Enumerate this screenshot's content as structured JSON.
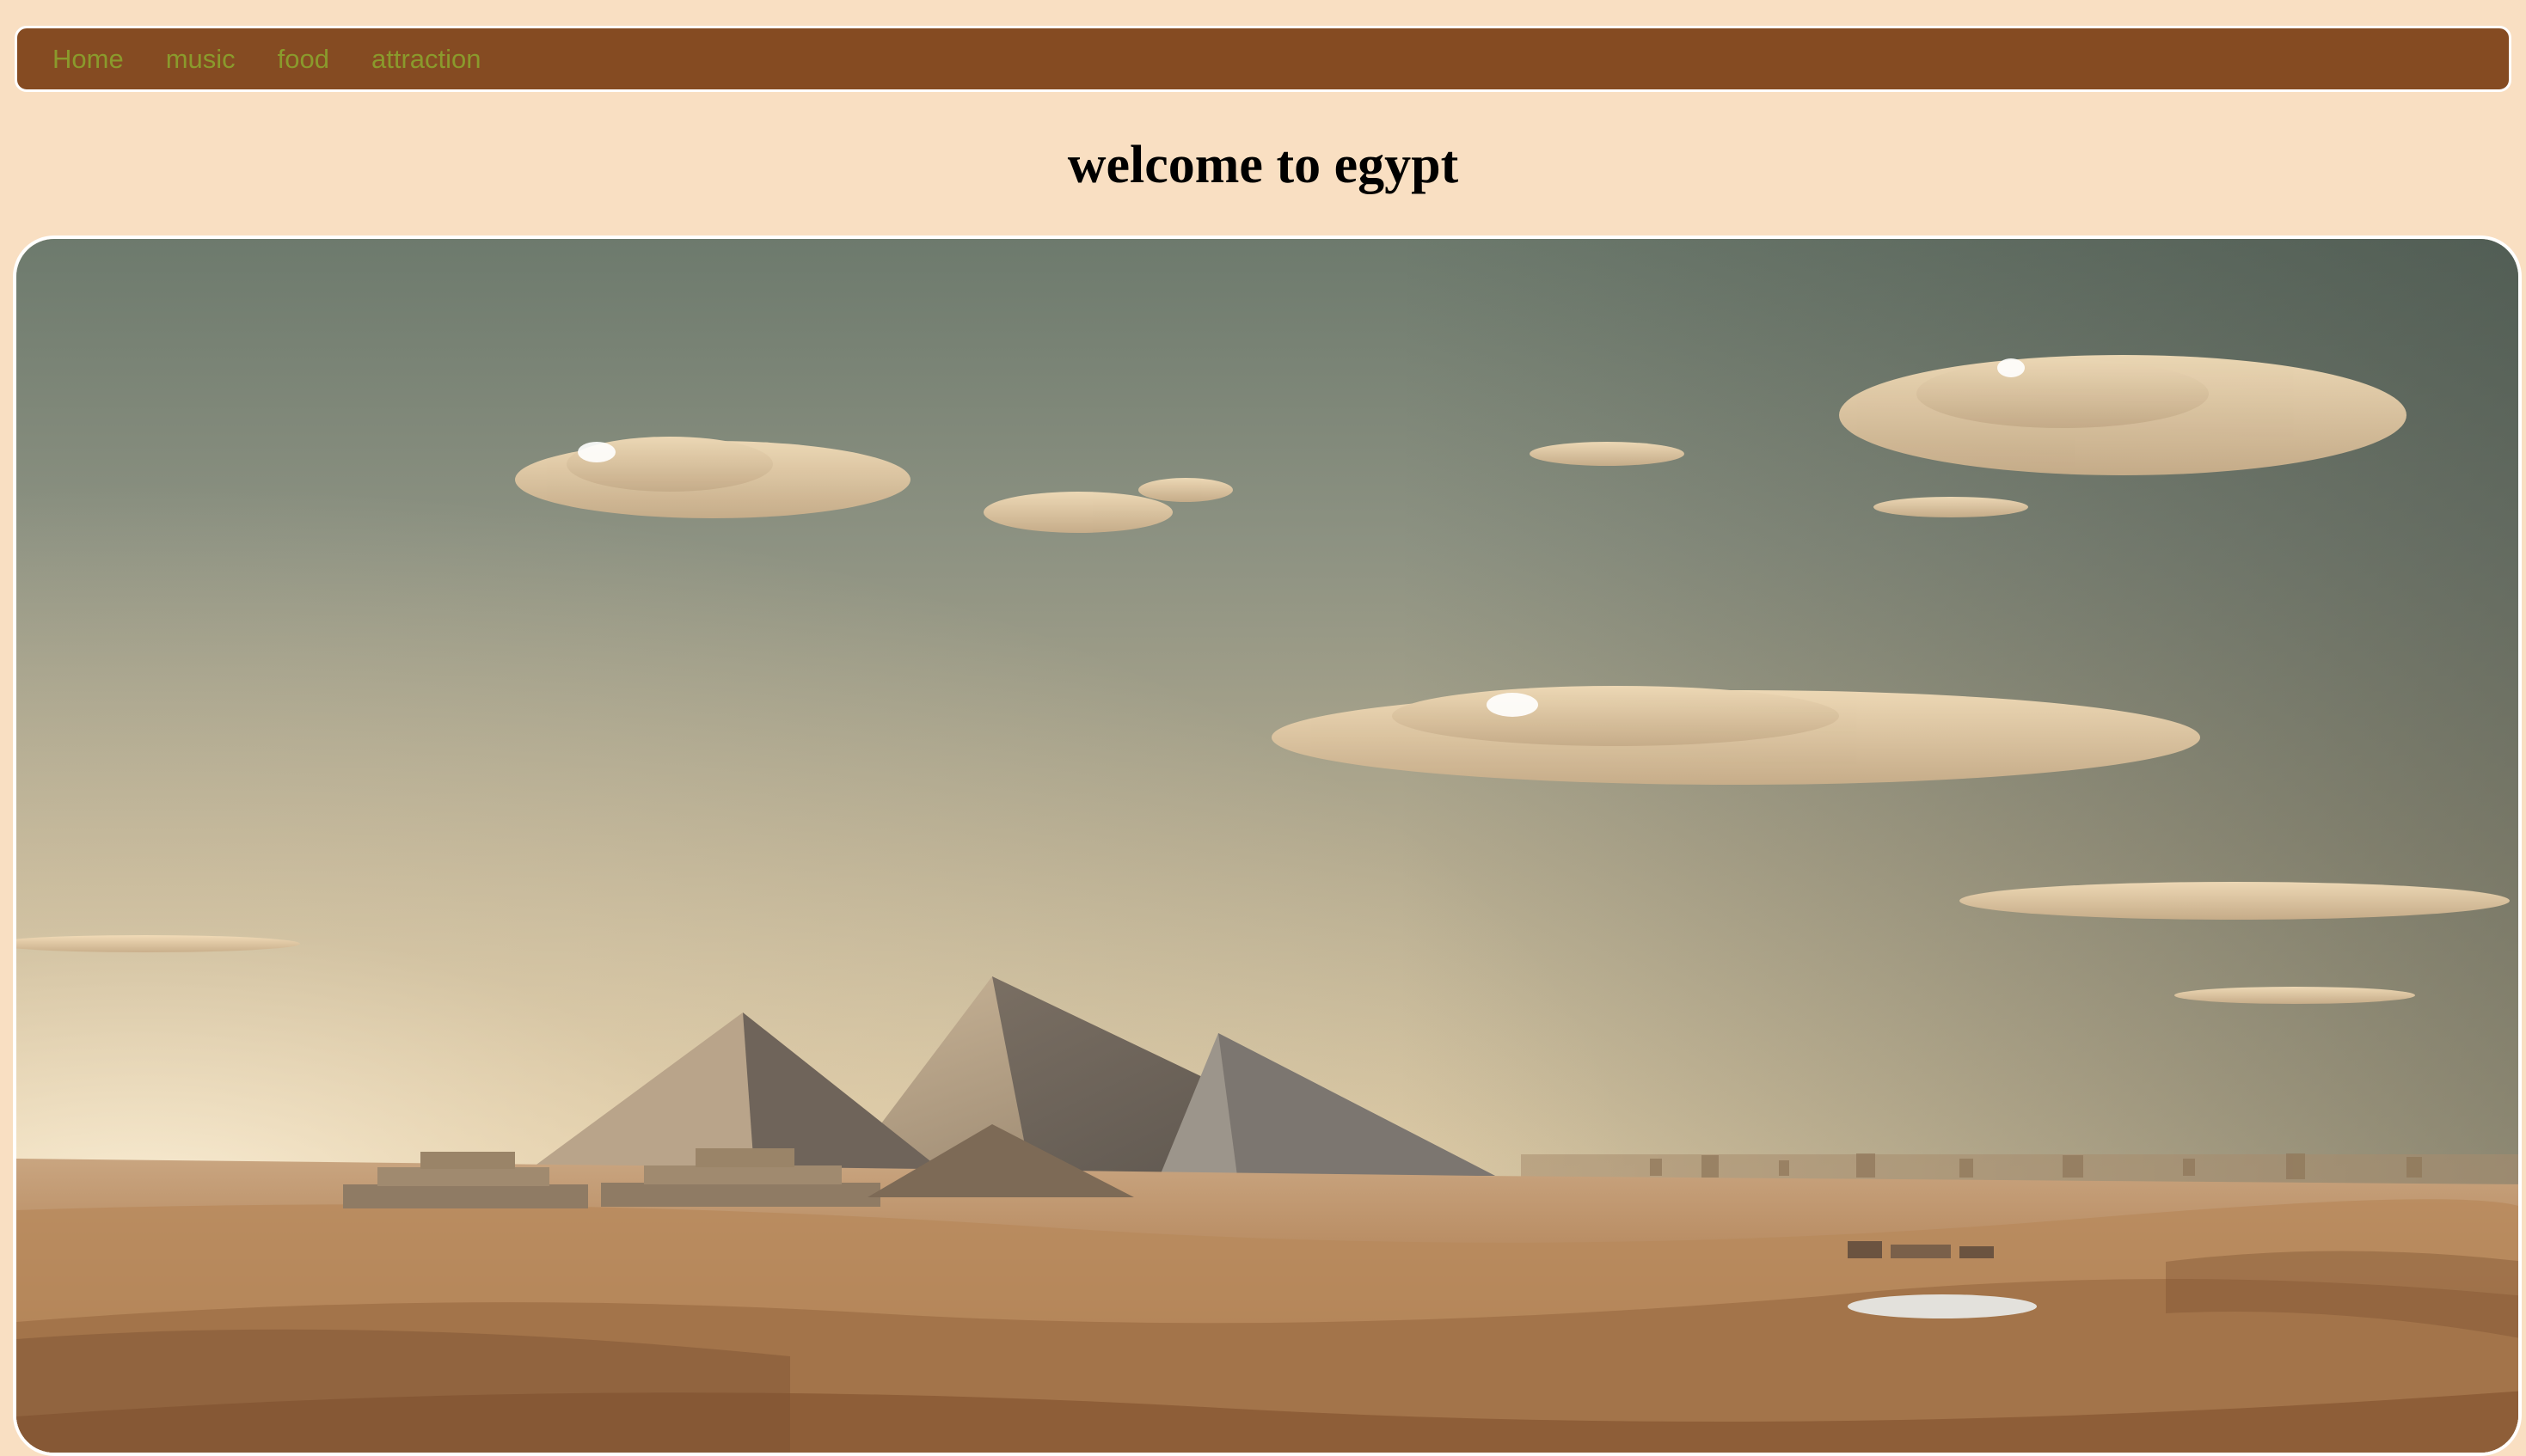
{
  "nav": {
    "items": [
      {
        "label": "Home"
      },
      {
        "label": "music"
      },
      {
        "label": "food"
      },
      {
        "label": "attraction"
      }
    ]
  },
  "page": {
    "title": "welcome to egypt"
  },
  "hero": {
    "image": "pyramids-desert-image",
    "scene": "pyramids-of-giza-desert-landscape"
  },
  "colors": {
    "background": "#f9dfc2",
    "navbar": "#854b22",
    "nav_link": "#8a9a2c",
    "title": "#000000",
    "border": "#ffffff"
  }
}
